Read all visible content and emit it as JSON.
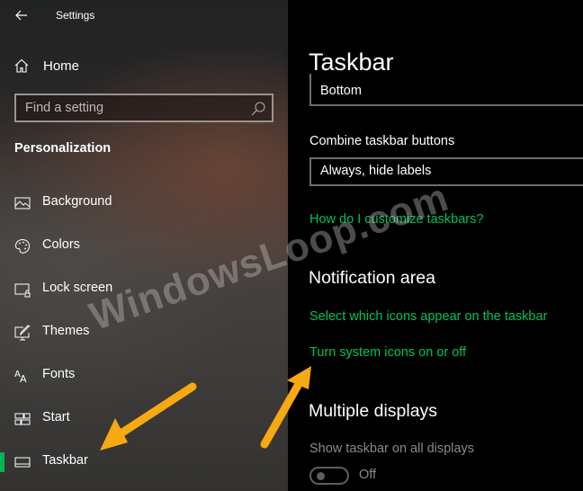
{
  "window": {
    "title": "Settings",
    "back_icon": "arrow-left-icon"
  },
  "sidebar": {
    "home": {
      "label": "Home",
      "icon": "home-icon"
    },
    "search": {
      "placeholder": "Find a setting",
      "value": "",
      "icon": "search-icon"
    },
    "section_title": "Personalization",
    "items": [
      {
        "label": "Background",
        "icon": "image-icon",
        "active": false
      },
      {
        "label": "Colors",
        "icon": "palette-icon",
        "active": false
      },
      {
        "label": "Lock screen",
        "icon": "lock-screen-icon",
        "active": false
      },
      {
        "label": "Themes",
        "icon": "themes-icon",
        "active": false
      },
      {
        "label": "Fonts",
        "icon": "fonts-icon",
        "active": false
      },
      {
        "label": "Start",
        "icon": "start-tiles-icon",
        "active": false
      },
      {
        "label": "Taskbar",
        "icon": "taskbar-icon",
        "active": true
      }
    ],
    "accent_color": "#00b450"
  },
  "content": {
    "title": "Taskbar",
    "taskbar_location_value": "Bottom",
    "combine_label": "Combine taskbar buttons",
    "combine_value": "Always, hide labels",
    "customize_link": "How do I customize taskbars?",
    "notification_area": {
      "heading": "Notification area",
      "links": [
        "Select which icons appear on the taskbar",
        "Turn system icons on or off"
      ]
    },
    "multiple_displays": {
      "heading": "Multiple displays",
      "show_all_label": "Show taskbar on all displays",
      "toggle_state": "Off",
      "toggle_on": false
    },
    "link_color": "#00c25a"
  },
  "annotations": {
    "watermark": "WindowsLoop.com",
    "arrow_color": "#f6a910"
  }
}
